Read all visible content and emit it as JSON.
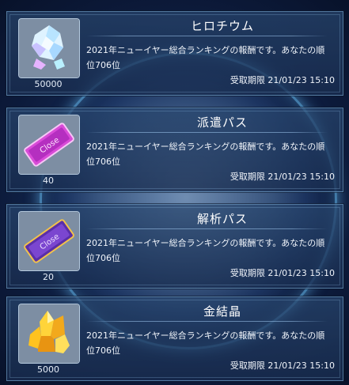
{
  "rewards": [
    {
      "name": "ヒロチウム",
      "quantity": "50000",
      "description": "2021年ニューイヤー総合ランキングの報酬です。あなたの順位706位",
      "expiry_label": "受取期限",
      "expiry": "21/01/23 15:10",
      "icon": "crystal-icon"
    },
    {
      "name": "派遣パス",
      "quantity": "40",
      "description": "2021年ニューイヤー総合ランキングの報酬です。あなたの順位706位",
      "expiry_label": "受取期限",
      "expiry": "21/01/23 15:10",
      "icon": "pink-ticket-icon",
      "ticket_text": "Close"
    },
    {
      "name": "解析パス",
      "quantity": "20",
      "description": "2021年ニューイヤー総合ランキングの報酬です。あなたの順位706位",
      "expiry_label": "受取期限",
      "expiry": "21/01/23 15:10",
      "icon": "purple-ticket-icon",
      "ticket_text": "Close"
    },
    {
      "name": "金結晶",
      "quantity": "5000",
      "description": "2021年ニューイヤー総合ランキングの報酬です。あなたの順位706位",
      "expiry_label": "受取期限",
      "expiry": "21/01/23 15:10",
      "icon": "gold-crystal-icon"
    }
  ],
  "colors": {
    "panel": "#233d66",
    "glow": "#6ec8ff",
    "text": "#ffffff"
  }
}
